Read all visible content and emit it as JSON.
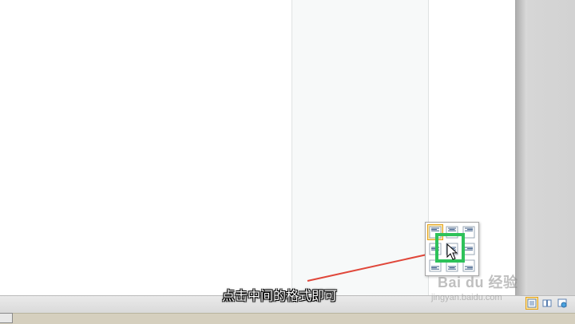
{
  "caption": "点击中间的格式即可",
  "watermark": {
    "brand": "Bai du 经验",
    "url": "jingyan.baidu.com"
  },
  "align_popup": {
    "cells": [
      {
        "icon": "align-top-left-icon",
        "selected": true
      },
      {
        "icon": "align-top-center-icon",
        "selected": false
      },
      {
        "icon": "align-top-right-icon",
        "selected": false
      },
      {
        "icon": "align-middle-left-icon",
        "selected": false
      },
      {
        "icon": "align-middle-center-icon",
        "selected": false
      },
      {
        "icon": "align-middle-right-icon",
        "selected": false
      },
      {
        "icon": "align-bottom-left-icon",
        "selected": false
      },
      {
        "icon": "align-bottom-center-icon",
        "selected": false
      },
      {
        "icon": "align-bottom-right-icon",
        "selected": false
      }
    ]
  },
  "status_bar": {
    "view_buttons": [
      {
        "icon": "print-layout-icon",
        "active": true
      },
      {
        "icon": "full-screen-reading-icon",
        "active": false
      },
      {
        "icon": "web-layout-icon",
        "active": false
      }
    ]
  },
  "colors": {
    "highlight": "#2ec25a",
    "arrow": "#e0473a",
    "selected_cell": "#fde7a8"
  }
}
